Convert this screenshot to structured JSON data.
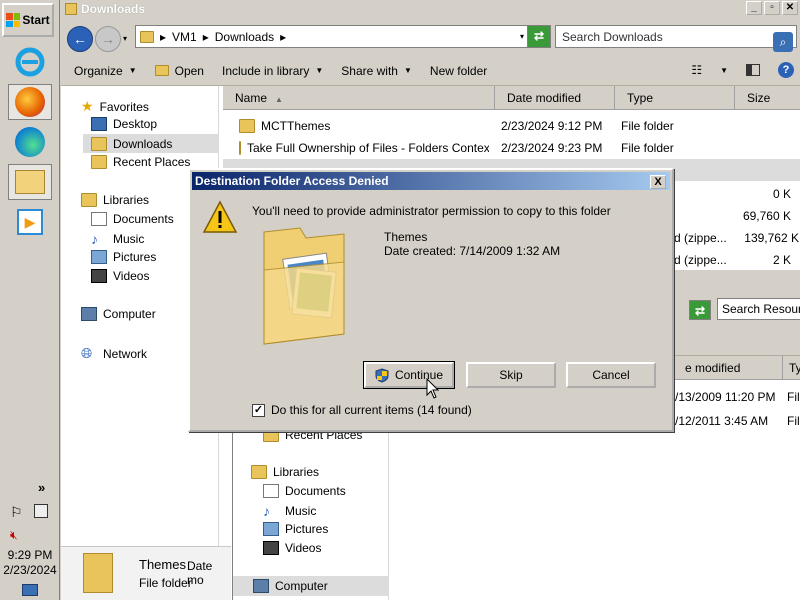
{
  "taskbar": {
    "start_label": "Start",
    "clock_time": "9:29 PM",
    "clock_date": "2/23/2024",
    "tray_chevron": "»"
  },
  "explorer": {
    "title": "Downloads",
    "address": {
      "path": [
        "VM1",
        "Downloads"
      ],
      "separator": "▸"
    },
    "search_placeholder": "Search Downloads",
    "toolbar": {
      "organize": "Organize",
      "open": "Open",
      "include_in_library": "Include in library",
      "share_with": "Share with",
      "new_folder": "New folder"
    },
    "nav": {
      "favorites": "Favorites",
      "desktop": "Desktop",
      "downloads": "Downloads",
      "recent_places": "Recent Places",
      "libraries": "Libraries",
      "documents": "Documents",
      "music": "Music",
      "pictures": "Pictures",
      "videos": "Videos",
      "computer": "Computer",
      "network": "Network"
    },
    "columns": {
      "name": "Name",
      "date_modified": "Date modified",
      "type": "Type",
      "size": "Size"
    },
    "files": [
      {
        "name": "MCTThemes",
        "date": "2/23/2024 9:12 PM",
        "type": "File folder"
      },
      {
        "name": "Take Full Ownership of Files - Folders Contex...",
        "date": "2/23/2024 9:23 PM",
        "type": "File folder"
      }
    ],
    "partial_sizes": [
      "0 K",
      "69,760 K",
      "139,762 K",
      "2 K"
    ],
    "partial_types": [
      "d (zippe...",
      "d (zippe..."
    ],
    "details": {
      "name": "Themes",
      "date_label": "Date mo",
      "type": "File folder"
    }
  },
  "second_window": {
    "search_placeholder": "Search Resourc",
    "column_date": "e modified",
    "column_type": "Ty",
    "rows": [
      {
        "date": "/13/2009 11:20 PM",
        "type": "Fil"
      },
      {
        "date": "/12/2011 3:45 AM",
        "type": "Fil"
      }
    ],
    "nav": {
      "recent_places": "Recent Places",
      "libraries": "Libraries",
      "documents": "Documents",
      "music": "Music",
      "pictures": "Pictures",
      "videos": "Videos",
      "computer": "Computer"
    }
  },
  "dialog": {
    "title": "Destination Folder Access Denied",
    "close": "X",
    "message": "You'll need to provide administrator permission to copy to this folder",
    "item_name": "Themes",
    "item_date": "Date created: 7/14/2009 1:32 AM",
    "continue": "Continue",
    "skip": "Skip",
    "cancel": "Cancel",
    "checkbox_label": "Do this for all current items (14 found)",
    "checkbox_checked": true
  }
}
